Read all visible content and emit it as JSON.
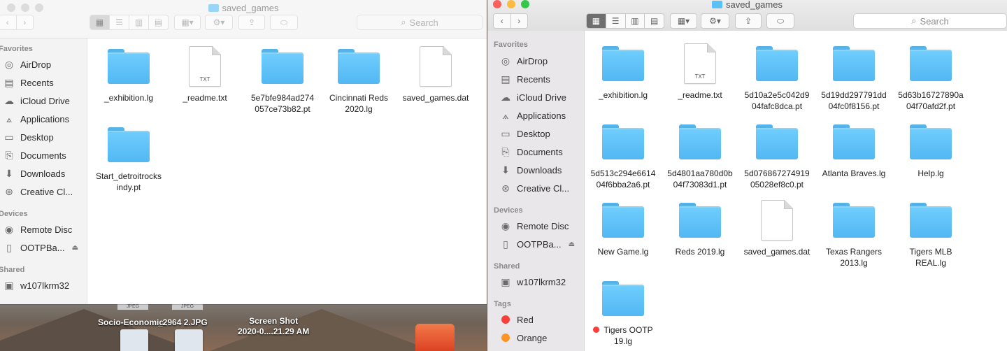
{
  "colors": {
    "close": "#fc605b",
    "minimize": "#fdbc40",
    "zoom": "#34c84a",
    "folder": "#5ac0f6",
    "tag_red": "#fc3d39",
    "tag_orange": "#fd9426"
  },
  "desktop": {
    "items": [
      {
        "label": "Socio-Economic"
      },
      {
        "label": "_2964 2.JPG"
      },
      {
        "label_line1": "Screen Shot",
        "label_line2": "2020-0....21.29 AM"
      }
    ],
    "tag": "JPEG"
  },
  "back_window": {
    "title": "saved_games",
    "search_label": "Search",
    "sidebar": {
      "favorites_head": "Favorites",
      "favorites": [
        {
          "label": "AirDrop",
          "icon": "airdrop-icon"
        },
        {
          "label": "Recents",
          "icon": "recents-icon"
        },
        {
          "label": "iCloud Drive",
          "icon": "cloud-icon"
        },
        {
          "label": "Applications",
          "icon": "applications-icon"
        },
        {
          "label": "Desktop",
          "icon": "desktop-icon"
        },
        {
          "label": "Documents",
          "icon": "documents-icon"
        },
        {
          "label": "Downloads",
          "icon": "downloads-icon"
        },
        {
          "label": "Creative Cl...",
          "icon": "creative-cloud-icon"
        }
      ],
      "devices_head": "Devices",
      "devices": [
        {
          "label": "Remote Disc",
          "icon": "disc-icon"
        },
        {
          "label": "OOTPBa...",
          "icon": "drive-icon"
        }
      ],
      "shared_head": "Shared",
      "shared": [
        {
          "label": "w107lkrm32",
          "icon": "computer-icon"
        }
      ]
    },
    "files": [
      {
        "type": "folder",
        "line1": "_exhibition.lg",
        "line2": ""
      },
      {
        "type": "txt",
        "ext": "TXT",
        "line1": "_readme.txt",
        "line2": ""
      },
      {
        "type": "folder",
        "line1": "5e7bfe984ad274",
        "line2": "057ce73b82.pt"
      },
      {
        "type": "folder",
        "line1": "Cincinnati Reds",
        "line2": "2020.lg"
      },
      {
        "type": "doc",
        "line1": "saved_games.dat",
        "line2": ""
      },
      {
        "type": "folder",
        "line1": "Start_detroitrocks",
        "line2": "indy.pt"
      }
    ]
  },
  "front_window": {
    "title": "saved_games",
    "search_label": "Search",
    "sidebar": {
      "favorites_head": "Favorites",
      "favorites": [
        {
          "label": "AirDrop"
        },
        {
          "label": "Recents"
        },
        {
          "label": "iCloud Drive"
        },
        {
          "label": "Applications"
        },
        {
          "label": "Desktop"
        },
        {
          "label": "Documents"
        },
        {
          "label": "Downloads"
        },
        {
          "label": "Creative Cl..."
        }
      ],
      "devices_head": "Devices",
      "devices": [
        {
          "label": "Remote Disc"
        },
        {
          "label": "OOTPBa..."
        }
      ],
      "shared_head": "Shared",
      "shared": [
        {
          "label": "w107lkrm32"
        }
      ],
      "tags_head": "Tags",
      "tags": [
        {
          "label": "Red"
        },
        {
          "label": "Orange"
        }
      ]
    },
    "files": [
      {
        "type": "folder",
        "line1": "_exhibition.lg",
        "line2": ""
      },
      {
        "type": "txt",
        "ext": "TXT",
        "line1": "_readme.txt",
        "line2": ""
      },
      {
        "type": "folder",
        "line1": "5d10a2e5c042d9",
        "line2": "04fafc8dca.pt"
      },
      {
        "type": "folder",
        "line1": "5d19dd297791dd",
        "line2": "04fc0f8156.pt"
      },
      {
        "type": "folder",
        "line1": "5d63b16727890a",
        "line2": "04f70afd2f.pt"
      },
      {
        "type": "folder",
        "line1": "5d513c294e6614",
        "line2": "04f6bba2a6.pt"
      },
      {
        "type": "folder",
        "line1": "5d4801aa780d0b",
        "line2": "04f73083d1.pt"
      },
      {
        "type": "folder",
        "line1": "5d076867274919",
        "line2": "05028ef8c0.pt"
      },
      {
        "type": "folder",
        "line1": "Atlanta Braves.lg",
        "line2": ""
      },
      {
        "type": "folder",
        "line1": "Help.lg",
        "line2": ""
      },
      {
        "type": "folder",
        "line1": "New Game.lg",
        "line2": ""
      },
      {
        "type": "folder",
        "line1": "Reds 2019.lg",
        "line2": ""
      },
      {
        "type": "doc",
        "line1": "saved_games.dat",
        "line2": ""
      },
      {
        "type": "folder",
        "line1": "Texas Rangers",
        "line2": "2013.lg"
      },
      {
        "type": "folder",
        "line1": "Tigers MLB",
        "line2": "REAL.lg"
      },
      {
        "type": "folder",
        "tag": "red",
        "line1": "Tigers OOTP",
        "line2": "19.lg"
      }
    ]
  }
}
